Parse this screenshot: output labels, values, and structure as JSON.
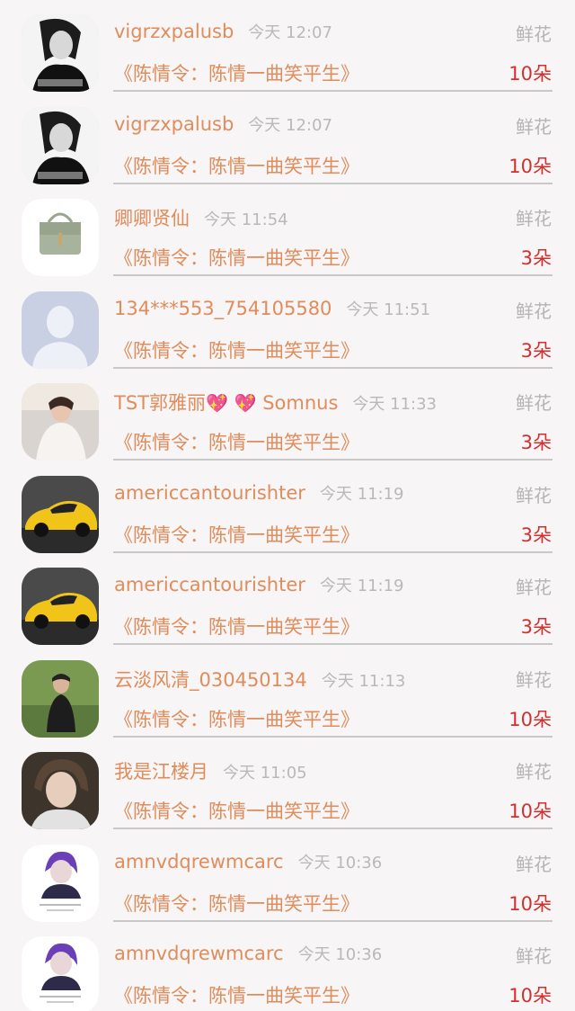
{
  "gift_records": [
    {
      "user": "vigrzxpalusb",
      "time": "今天 12:07",
      "gift_type": "鲜花",
      "title": "《陈情令：陈情一曲笑平生》",
      "count": "10朵",
      "avatar": "avatar-girl-bw"
    },
    {
      "user": "vigrzxpalusb",
      "time": "今天 12:07",
      "gift_type": "鲜花",
      "title": "《陈情令：陈情一曲笑平生》",
      "count": "10朵",
      "avatar": "avatar-girl-bw"
    },
    {
      "user": "卿卿贤仙",
      "time": "今天 11:54",
      "gift_type": "鲜花",
      "title": "《陈情令：陈情一曲笑平生》",
      "count": "3朵",
      "avatar": "avatar-handbag"
    },
    {
      "user": "134***553_754105580",
      "time": "今天 11:51",
      "gift_type": "鲜花",
      "title": "《陈情令：陈情一曲笑平生》",
      "count": "3朵",
      "avatar": "avatar-default"
    },
    {
      "user": "TST郭雅丽",
      "user_suffix": "Somnus",
      "time": "今天 11:33",
      "gift_type": "鲜花",
      "title": "《陈情令：陈情一曲笑平生》",
      "count": "3朵",
      "avatar": "avatar-bride"
    },
    {
      "user": "americcantourishter",
      "time": "今天 11:19",
      "gift_type": "鲜花",
      "title": "《陈情令：陈情一曲笑平生》",
      "count": "3朵",
      "avatar": "avatar-yellow-car"
    },
    {
      "user": "americcantourishter",
      "time": "今天 11:19",
      "gift_type": "鲜花",
      "title": "《陈情令：陈情一曲笑平生》",
      "count": "3朵",
      "avatar": "avatar-yellow-car"
    },
    {
      "user": "云淡风清_030450134",
      "time": "今天 11:13",
      "gift_type": "鲜花",
      "title": "《陈情令：陈情一曲笑平生》",
      "count": "10朵",
      "avatar": "avatar-man-garden"
    },
    {
      "user": "我是江楼月",
      "time": "今天 11:05",
      "gift_type": "鲜花",
      "title": "《陈情令：陈情一曲笑平生》",
      "count": "10朵",
      "avatar": "avatar-young-man"
    },
    {
      "user": "amnvdqrewmcarc",
      "time": "今天 10:36",
      "gift_type": "鲜花",
      "title": "《陈情令：陈情一曲笑平生》",
      "count": "10朵",
      "avatar": "avatar-purple-hair"
    },
    {
      "user": "amnvdqrewmcarc",
      "time": "今天 10:36",
      "gift_type": "鲜花",
      "title": "《陈情令：陈情一曲笑平生》",
      "count": "10朵",
      "avatar": "avatar-purple-hair"
    }
  ],
  "colors": {
    "name": "#e08c5b",
    "count": "#d0302e",
    "muted": "#b4b4b4",
    "background": "#f7f5f6"
  }
}
